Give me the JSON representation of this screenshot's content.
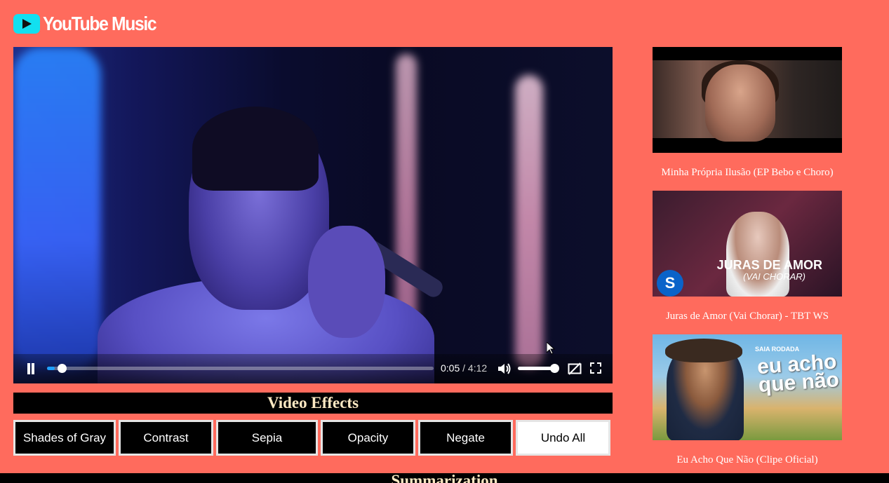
{
  "app": {
    "logo_text": "YouTube Music"
  },
  "player": {
    "current_time": "0:05",
    "time_separator": "/",
    "duration": "4:12",
    "progress": 0.02,
    "volume": 1.0
  },
  "effects": {
    "heading": "Video Effects",
    "buttons": [
      "Shades of Gray",
      "Contrast",
      "Sepia",
      "Opacity",
      "Negate",
      "Undo All"
    ]
  },
  "summary": {
    "heading": "Summarization"
  },
  "playlist": [
    {
      "title": "Minha Própria Ilusão (EP Bebo e Choro)"
    },
    {
      "title": "Juras de Amor (Vai Chorar) - TBT WS",
      "caption_main": "JURAS DE AMOR",
      "caption_sub": "(VAI CHORAR)",
      "badge": "S"
    },
    {
      "title": "Eu Acho Que Não (Clipe Oficial)",
      "brand": "SAIA RODADA",
      "caption_main": "eu acho que não"
    }
  ],
  "colors": {
    "page_background": "#ff6b5d",
    "accent": "#12e0f0",
    "progress_fill": "#1ea0ff",
    "heading_text": "#fde9c3"
  }
}
